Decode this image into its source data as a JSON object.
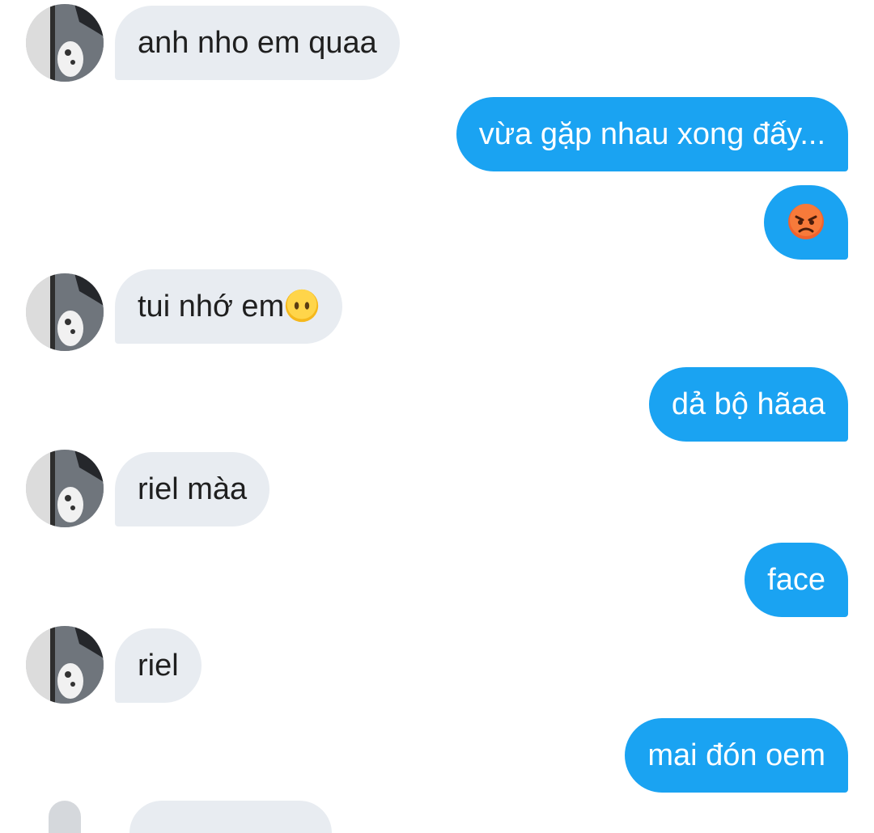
{
  "messages": [
    {
      "side": "in",
      "text": "anh nho em quaa"
    },
    {
      "side": "out",
      "text": "vừa gặp nhau xong đấy..."
    },
    {
      "side": "out",
      "emoji": "angry-face"
    },
    {
      "side": "in",
      "text": "tui nhớ em",
      "emoji": "face-without-mouth"
    },
    {
      "side": "out",
      "text": "dả bộ hãaa"
    },
    {
      "side": "in",
      "text": "riel màa"
    },
    {
      "side": "out",
      "text": "face"
    },
    {
      "side": "in",
      "text": "riel"
    },
    {
      "side": "out",
      "text": "mai đón oem"
    }
  ],
  "colors": {
    "incoming_bubble": "#e8ecf1",
    "outgoing_bubble": "#1aa3f2",
    "incoming_text": "#1f1f1f",
    "outgoing_text": "#ffffff"
  }
}
